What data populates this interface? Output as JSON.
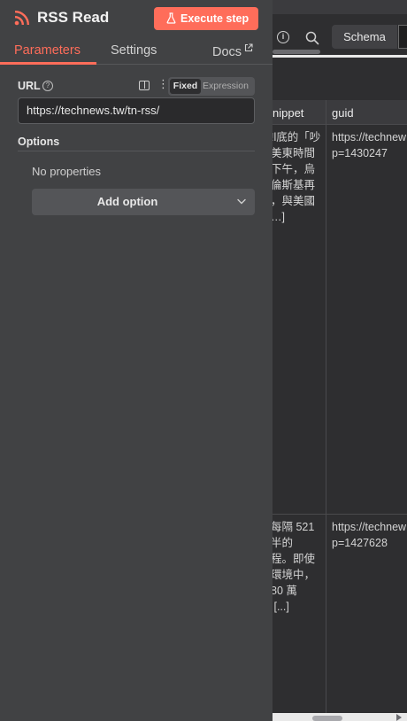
{
  "header": {
    "title": "RSS Read",
    "execute_label": "Execute step"
  },
  "tabs": [
    {
      "label": "Parameters",
      "active": true
    },
    {
      "label": "Settings",
      "active": false
    },
    {
      "label": "Docs",
      "active": false
    }
  ],
  "url_field": {
    "label": "URL",
    "value": "https://technews.tw/tn-rss/",
    "mode_fixed": "Fixed",
    "mode_expression": "Expression"
  },
  "options": {
    "label": "Options",
    "empty_text": "No properties",
    "add_label": "Add option"
  },
  "output": {
    "view_tab": "Schema",
    "columns": [
      "nippet",
      "guid"
    ],
    "rows": [
      {
        "snippet": "!l底的「吵\n美東時間\n下午，烏\n倫斯基再\n，與美國\n…]",
        "guid": "https://technew\np=1430247"
      },
      {
        "snippet": "每隔 521\n半的\n程。即使\n環境中，\n80 萬\n [...]",
        "guid": "https://technew\np=1427628"
      }
    ]
  },
  "colors": {
    "accent": "#ff6d5a",
    "panel": "#414244",
    "background": "#2e2e30"
  }
}
